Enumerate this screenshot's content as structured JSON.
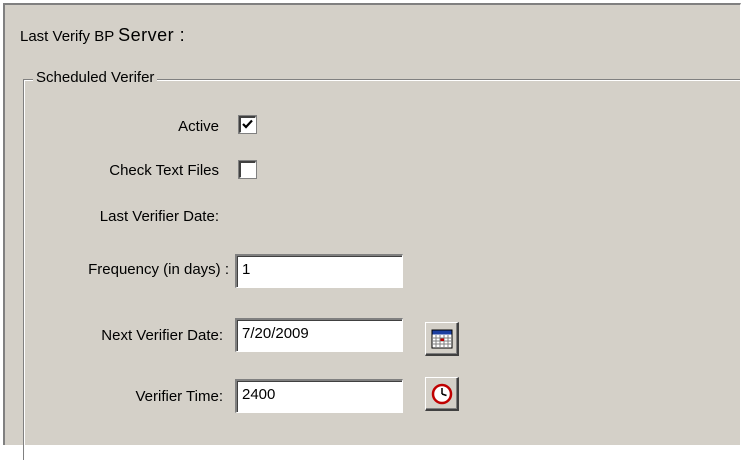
{
  "header": {
    "label_prefix": "Last Verify BP",
    "label_suffix": "Server :"
  },
  "group": {
    "title": "Scheduled Verifer"
  },
  "fields": {
    "active": {
      "label": "Active",
      "checked": true
    },
    "check_text_files": {
      "label": "Check Text Files",
      "checked": false
    },
    "last_verifier_date": {
      "label": "Last Verifier Date:"
    },
    "frequency": {
      "label": "Frequency (in days) :",
      "value": "1"
    },
    "next_verifier_date": {
      "label": "Next Verifier Date:",
      "value": "7/20/2009",
      "button_icon": "calendar-icon"
    },
    "verifier_time": {
      "label": "Verifier Time:",
      "value": "2400",
      "button_icon": "clock-icon"
    }
  },
  "colors": {
    "panel_bg": "#d4d0c8",
    "clock_ring": "#c00000",
    "calendar_header": "#c00000"
  }
}
